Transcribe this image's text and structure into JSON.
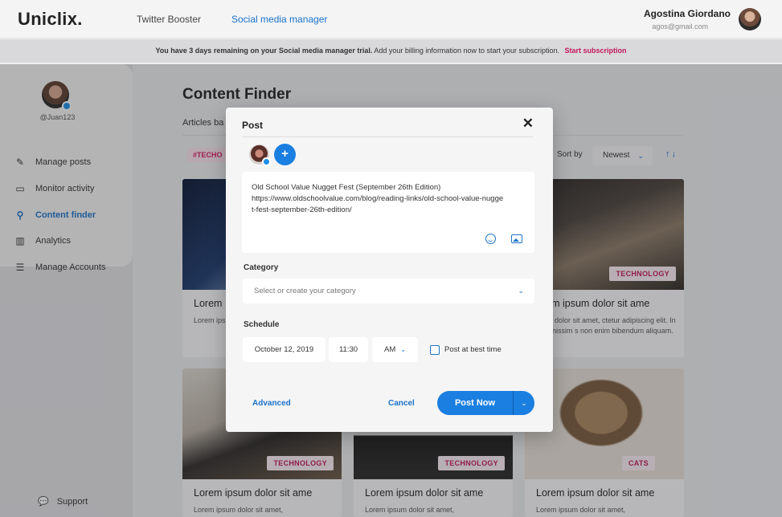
{
  "header": {
    "logo": "Uniclix.",
    "nav": [
      "Twitter Booster",
      "Social media manager"
    ],
    "user_name": "Agostina Giordano",
    "user_email": "agos@gmail.com"
  },
  "banner": {
    "bold": "You have 3 days remaining on your Social media manager trial.",
    "text": "Add your billing information now to start your subscription.",
    "cta": "Start subscription"
  },
  "sidebar": {
    "handle": "@Juan123",
    "items": [
      {
        "label": "Manage posts",
        "icon": "pencil-icon"
      },
      {
        "label": "Monitor activity",
        "icon": "monitor-icon"
      },
      {
        "label": "Content finder",
        "icon": "search-icon"
      },
      {
        "label": "Analytics",
        "icon": "analytics-icon"
      },
      {
        "label": "Manage Accounts",
        "icon": "list-icon"
      }
    ],
    "support": "Support"
  },
  "main": {
    "title": "Content Finder",
    "subtitle": "Articles ba",
    "tag": "#TECHO",
    "sort_label": "Sort by",
    "sort_value": "Newest",
    "cards": [
      {
        "title": "Lorem",
        "desc": "Lorem ips consectet lectus nor",
        "badge": ""
      },
      {
        "title": "rem ipsum dolor sit ame",
        "desc": "um dolor sit amet, ctetur adipiscing elit. In dignissim s non enim bibendum aliquam.",
        "badge": "TECHNOLOGY"
      },
      {
        "title": "Lorem ipsum dolor sit ame",
        "desc": "Lorem ipsum dolor sit amet,",
        "badge": "TECHNOLOGY"
      },
      {
        "title": "Lorem ipsum dolor sit ame",
        "desc": "Lorem ipsum dolor sit amet,",
        "badge": "TECHNOLOGY"
      },
      {
        "title": "Lorem ipsum dolor sit ame",
        "desc": "Lorem ipsum dolor sit amet,",
        "badge": "CATS"
      }
    ]
  },
  "modal": {
    "title": "Post",
    "text_lines": [
      "Old School Value Nugget Fest (September 26th Edition)",
      "https://www.oldschoolvalue.com/blog/reading-links/old-school-value-nugge",
      "t-fest-september-26th-edition/"
    ],
    "category_label": "Category",
    "category_placeholder": "Select or create your category",
    "schedule_label": "Schedule",
    "date": "October 12, 2019",
    "time": "11:30",
    "ampm": "AM",
    "best_time_label": "Post at best time",
    "advanced": "Advanced",
    "cancel": "Cancel",
    "post_now": "Post Now"
  }
}
